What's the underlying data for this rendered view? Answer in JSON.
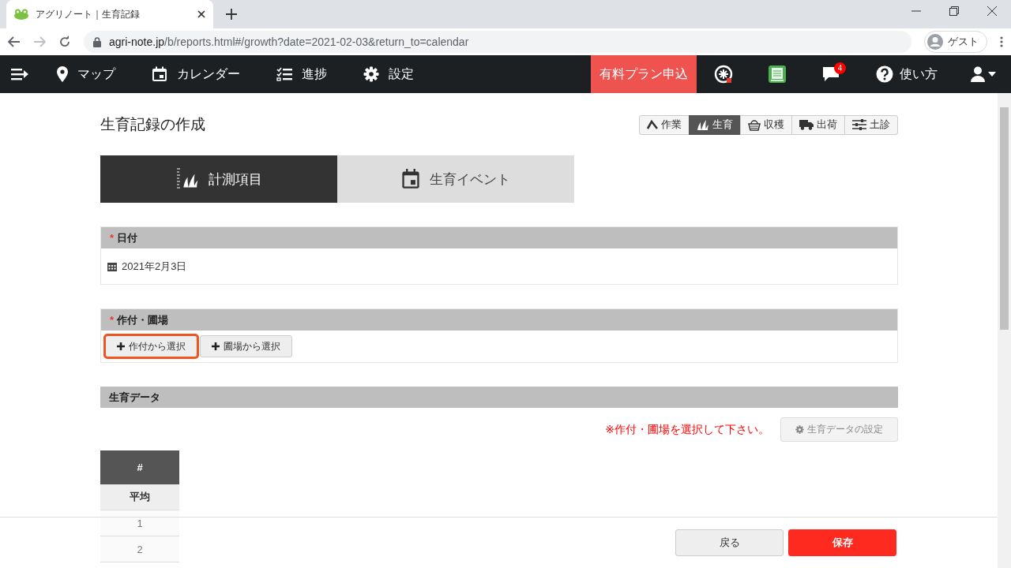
{
  "browser": {
    "tab_title": "アグリノート｜生育記録",
    "url_host": "agri-note.jp",
    "url_path": "/b/reports.html#/growth?date=2021-02-03&return_to=calendar",
    "profile": "ゲスト"
  },
  "nav": {
    "items": [
      {
        "label": "マップ"
      },
      {
        "label": "カレンダー"
      },
      {
        "label": "進捗"
      },
      {
        "label": "設定"
      }
    ],
    "plan_button": "有料プラン申込",
    "notification_count": "4",
    "help": "使い方"
  },
  "page": {
    "title": "生育記録の作成",
    "record_types": [
      {
        "label": "作業",
        "selected": false
      },
      {
        "label": "生育",
        "selected": true
      },
      {
        "label": "収穫",
        "selected": false
      },
      {
        "label": "出荷",
        "selected": false
      },
      {
        "label": "土診",
        "selected": false
      }
    ],
    "tabs": [
      {
        "label": "計測項目",
        "selected": true
      },
      {
        "label": "生育イベント",
        "selected": false
      }
    ],
    "sections": [
      {
        "kind": "date",
        "required_mark": "*",
        "title": "日付",
        "value": "2021年2月3日"
      },
      {
        "kind": "select",
        "required_mark": "*",
        "title": "作付・圃場",
        "buttons": [
          {
            "label": "作付から選択",
            "highlighted": true
          },
          {
            "label": "圃場から選択",
            "highlighted": false
          }
        ]
      },
      {
        "kind": "data",
        "title": "生育データ",
        "message": "※作付・圃場を選択して下さい。",
        "settings_button": "生育データの設定",
        "table": {
          "header": "#",
          "rows": [
            "平均",
            "1",
            "2"
          ]
        }
      }
    ]
  },
  "footer": {
    "back_button": "戻る",
    "save_button": "保存"
  }
}
